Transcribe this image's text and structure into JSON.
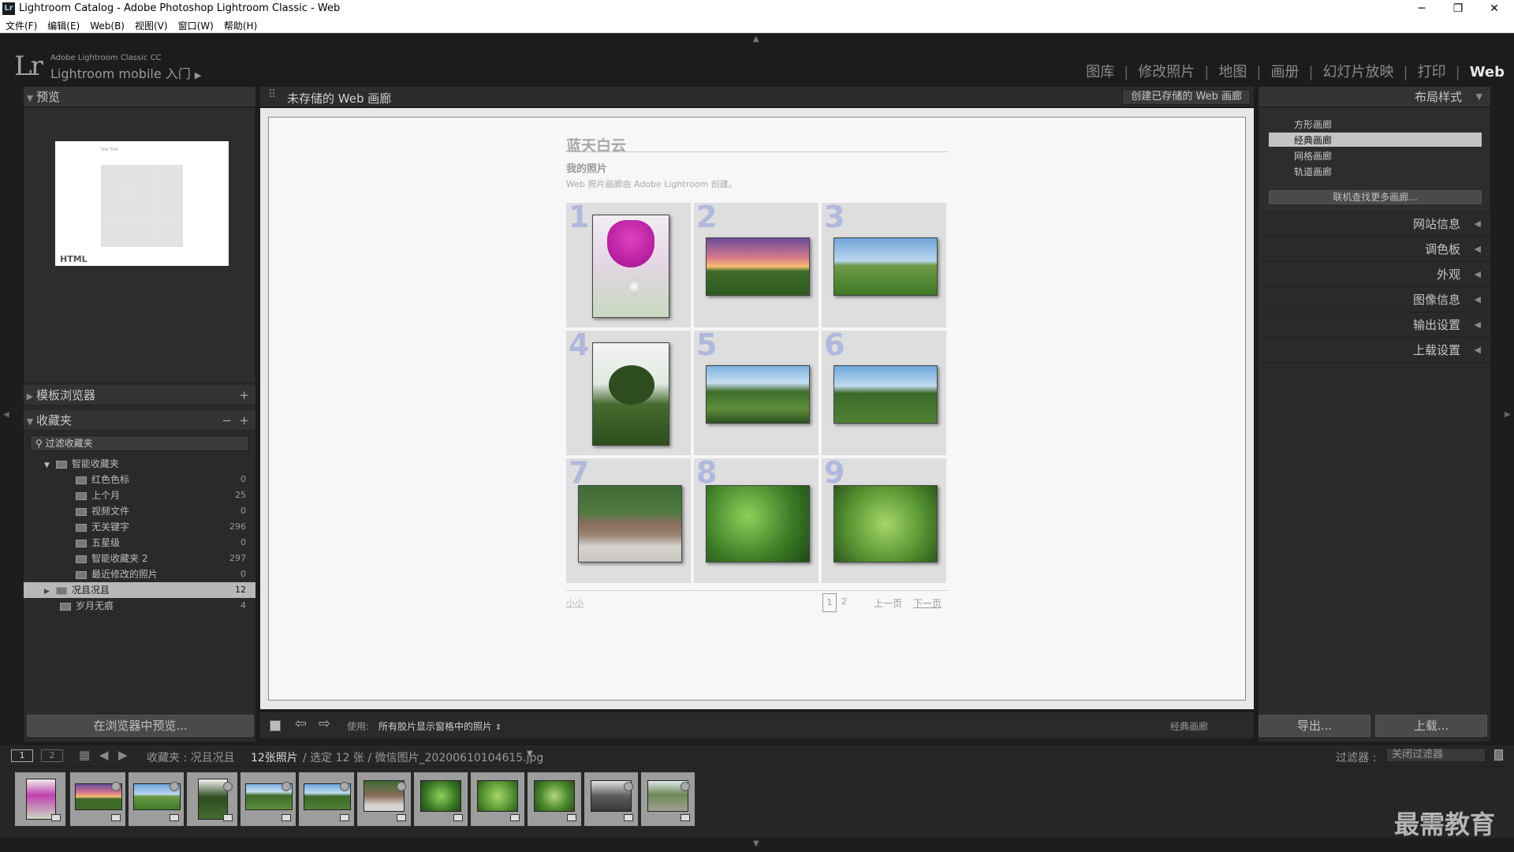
{
  "window": {
    "title": "Lightroom Catalog - Adobe Photoshop Lightroom Classic - Web",
    "icon": "Lr"
  },
  "menu": [
    "文件(F)",
    "编辑(E)",
    "Web(B)",
    "视图(V)",
    "窗口(W)",
    "帮助(H)"
  ],
  "identity": {
    "logo": "Lr",
    "product": "Adobe Lightroom Classic CC",
    "mobile": "Lightroom mobile 入门"
  },
  "modules": [
    "图库",
    "修改照片",
    "地图",
    "画册",
    "幻灯片放映",
    "打印",
    "Web"
  ],
  "active_module": "Web",
  "left": {
    "preview_title": "预览",
    "preview_html_label": "HTML",
    "preview_mini_title": "Site Title",
    "template_browser": "模板浏览器",
    "collections_title": "收藏夹",
    "filter_placeholder": "过滤收藏夹",
    "smart_folder": "智能收藏夹",
    "items": [
      {
        "label": "红色色标",
        "count": "0"
      },
      {
        "label": "上个月",
        "count": "25"
      },
      {
        "label": "视频文件",
        "count": "0"
      },
      {
        "label": "无关键字",
        "count": "296"
      },
      {
        "label": "五星级",
        "count": "0"
      },
      {
        "label": "智能收藏夹 2",
        "count": "297"
      },
      {
        "label": "最近修改的照片",
        "count": "0"
      }
    ],
    "selected": {
      "label": "况且况且",
      "count": "12"
    },
    "other": {
      "label": "岁月无痕",
      "count": "4"
    },
    "preview_button": "在浏览器中预览..."
  },
  "center": {
    "title": "未存储的 Web 画廊",
    "create_button": "创建已存储的 Web 画廊",
    "gallery_title": "蓝天白云",
    "gallery_subtitle": "我的照片",
    "gallery_desc": "Web 照片画廊由 Adobe Lightroom 创建。",
    "cells": [
      "1",
      "2",
      "3",
      "4",
      "5",
      "6",
      "7",
      "8",
      "9"
    ],
    "footer_left": "小小",
    "pages": [
      "1",
      "2"
    ],
    "prev": "上一页",
    "next": "下一页"
  },
  "toolbar": {
    "use_label": "使用:",
    "use_value": "所有胶片显示窗格中的照片",
    "layout_name": "经典画廊"
  },
  "right": {
    "layout_title": "布局样式",
    "layouts": [
      "方形画廊",
      "经典画廊",
      "网格画廊",
      "轨道画廊"
    ],
    "selected_layout": "经典画廊",
    "more": "联机查找更多画廊...",
    "sections": [
      "网站信息",
      "调色板",
      "外观",
      "图像信息",
      "输出设置",
      "上载设置"
    ],
    "export": "导出...",
    "upload": "上载..."
  },
  "filmstrip": {
    "screen1": "1",
    "screen2": "2",
    "path": "收藏夹 : 况且况且",
    "count": "12张照片",
    "selection": "/ 选定 12 张 / 微信图片_20200610104615.jpg",
    "filter_label": "过滤器 :",
    "filter_value": "关闭过滤器"
  },
  "watermark": "最需教育"
}
